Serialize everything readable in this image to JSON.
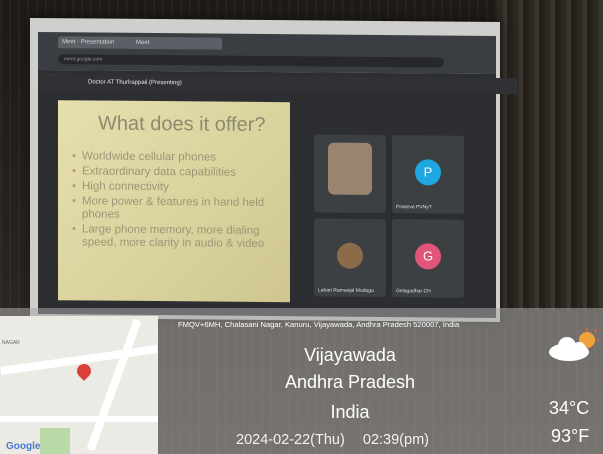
{
  "browser": {
    "tabs": [
      "Meet - Presentation",
      "Meet",
      ""
    ],
    "url": "meet.google.com"
  },
  "meet": {
    "presenting_label": "Doctor AT Thurlrappali (Presenting)",
    "participants": [
      {
        "name": "",
        "initial": "",
        "color": "#7a6a5a"
      },
      {
        "name": "Praneva PVNyT",
        "initial": "P",
        "color": "#1ea7e1"
      },
      {
        "name": "Lahari Ramanjal Modugu",
        "initial": "",
        "color": "#8c6a4a"
      },
      {
        "name": "Gelagadhar CH",
        "initial": "G",
        "color": "#e2557a"
      }
    ]
  },
  "slide": {
    "title": "What does it offer?",
    "bullets": [
      "Worldwide cellular phones",
      "Extraordinary data capabilities",
      "High connectivity",
      "More power & features in hand held phones",
      "Large phone memory, more dialing speed, more clarity in audio & video"
    ]
  },
  "overlay": {
    "address": "FMQV+6MH, Chalasani Nagar, Kanuru, Vijayawada, Andhra Pradesh 520007, India",
    "city": "Vijayawada",
    "state": "Andhra Pradesh",
    "country": "India",
    "date": "2024-02-22(Thu)",
    "time": "02:39(pm)",
    "temp_c": "34°C",
    "temp_f": "93°F"
  },
  "map": {
    "label_nagar": "NAGAR",
    "brand": "Google"
  }
}
